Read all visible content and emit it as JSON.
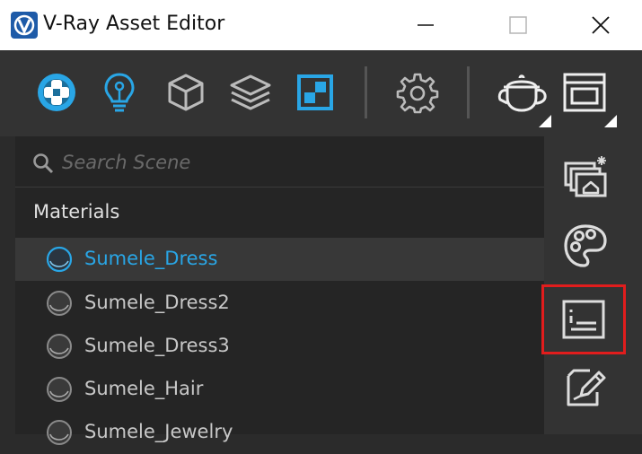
{
  "window": {
    "title": "V-Ray Asset Editor"
  },
  "colors": {
    "accent": "#29a6e6",
    "highlight": "#e11d1d",
    "panel": "#252525",
    "toolbar": "#333333"
  },
  "toolbar": {
    "icons": [
      "materials-icon",
      "lights-icon",
      "geometry-icon",
      "layers-icon",
      "render-elements-icon",
      "settings-icon",
      "render-icon",
      "frame-buffer-icon"
    ]
  },
  "search": {
    "placeholder": "Search Scene",
    "value": ""
  },
  "materials": {
    "title": "Materials",
    "items": [
      {
        "label": "Sumele_Dress",
        "selected": true
      },
      {
        "label": "Sumele_Dress2",
        "selected": false
      },
      {
        "label": "Sumele_Dress3",
        "selected": false
      },
      {
        "label": "Sumele_Hair",
        "selected": false
      },
      {
        "label": "Sumele_Jewelry",
        "selected": false
      }
    ]
  },
  "side_panel": {
    "buttons": [
      "create-asset-icon",
      "material-library-icon",
      "asset-properties-icon",
      "edit-asset-icon"
    ],
    "highlighted": "asset-properties-icon"
  }
}
